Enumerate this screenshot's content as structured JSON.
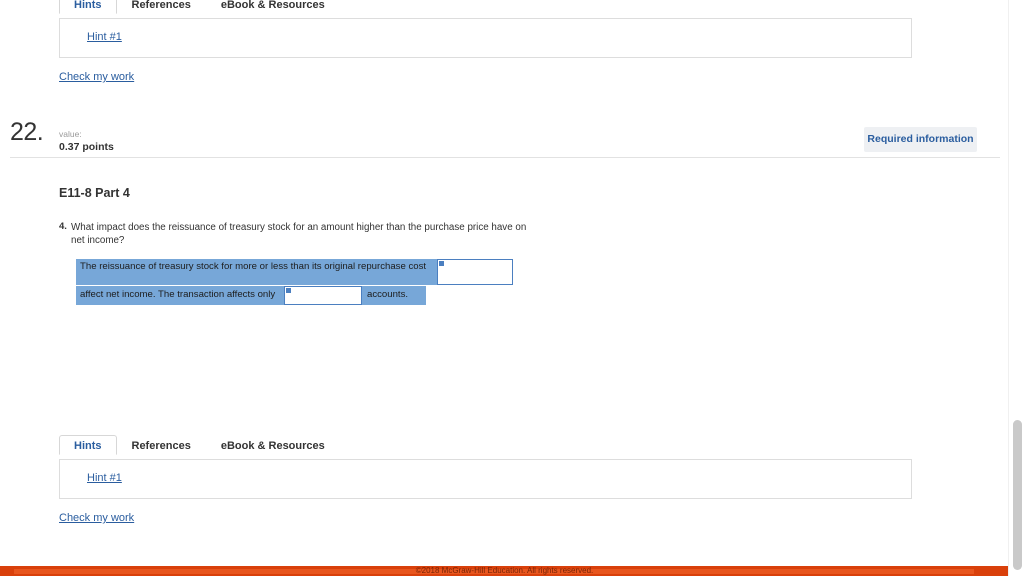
{
  "top_section": {
    "tabs": [
      {
        "label": "Hints",
        "active": true
      },
      {
        "label": "References",
        "active": false
      },
      {
        "label": "eBook & Resources",
        "active": false
      }
    ],
    "hint_link": "Hint #1",
    "check_my_work": "Check my work"
  },
  "question": {
    "number": "22.",
    "value_label": "value:",
    "points": "0.37 points",
    "required_information_button": "Required information",
    "exercise_title": "E11-8 Part 4",
    "sub_number": "4.",
    "prompt": "What impact does the reissuance of treasury stock for an amount higher than the purchase price have on net income?",
    "statement": {
      "fragment_1": "The reissuance of treasury stock for more or less than its original repurchase cost",
      "blank_1_value": "",
      "blank_1_placeholder": "",
      "fragment_2": "affect net income. The transaction affects only",
      "blank_2_value": "",
      "blank_2_placeholder": "",
      "fragment_3": "accounts."
    }
  },
  "bottom_section": {
    "tabs": [
      {
        "label": "Hints",
        "active": true
      },
      {
        "label": "References",
        "active": false
      },
      {
        "label": "eBook & Resources",
        "active": false
      }
    ],
    "hint_link": "Hint #1",
    "check_my_work": "Check my work"
  },
  "footer": {
    "copyright": "©2018 McGraw-Hill Education. All rights reserved."
  },
  "colors": {
    "highlight_blue": "#77a7d8",
    "input_border_blue": "#4b7fc0",
    "link_blue": "#2a5d9f",
    "footer_orange": "#d9400b",
    "badge_bg": "#eef0f3"
  }
}
